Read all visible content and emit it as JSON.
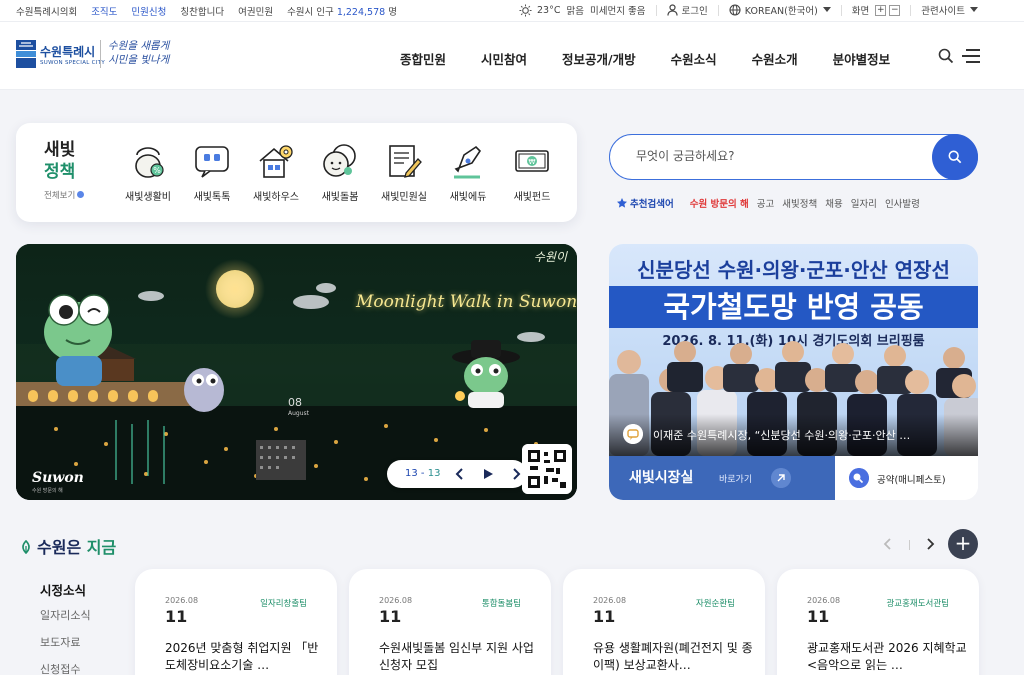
{
  "topbar": {
    "left_links": [
      "수원특례시의회",
      "조직도",
      "민원신청",
      "칭찬합니다",
      "여권민원"
    ],
    "population_label": "수원시 인구",
    "population_value": "1,224,578",
    "population_unit": "명",
    "weather_temp": "23°C",
    "weather_state": "맑음",
    "dust": "미세먼지 좋음",
    "login": "로그인",
    "language": "KOREAN(한국어)",
    "screen_label": "화면",
    "zoom_in": "+",
    "zoom_out": "−",
    "related_sites": "관련사이트"
  },
  "header": {
    "logo_name": "수원특례시",
    "logo_en": "SUWON SPECIAL CITY",
    "slogan_line1": "수원을 새롭게",
    "slogan_line2": "시민을 빛나게",
    "nav": [
      "종합민원",
      "시민참여",
      "정보공개/개방",
      "수원소식",
      "수원소개",
      "분야별정보"
    ]
  },
  "quick_menu": {
    "title_line1": "새빛",
    "title_line2": "정책",
    "view_all": "전체보기",
    "items": [
      "새빛생활비",
      "새빛톡톡",
      "새빛하우스",
      "새빛돌봄",
      "새빛민원실",
      "새빛에듀",
      "새빛펀드"
    ]
  },
  "search": {
    "placeholder": "무엇이 궁금하세요?",
    "keywords_label": "추천검색어",
    "keywords": [
      "수원 방문의 해",
      "공고",
      "새빛정책",
      "채용",
      "일자리",
      "인사발령"
    ]
  },
  "banner": {
    "headline": "Moonlight Walk in Suwon!",
    "tag": "수원이",
    "date": "08",
    "date_sub": "August",
    "brand": "Suwon",
    "brand_sub": "수원 방문의 해",
    "counter_current": "13",
    "counter_total": "13",
    "counter_sep": " - "
  },
  "cityhall": {
    "headline1": "신분당선 수원·의왕·군포·안산 연장선",
    "headline2": "국가철도망 반영 공동",
    "headline3": "2026. 8. 11.(화) 10시   경기도의회 브리핑룸",
    "caption": "이재준 수원특례시장, “신분당선 수원·의왕·군포·안산 …",
    "link_title": "새빛시장실",
    "link_go": "바로가기",
    "manifesto": "공약(매니페스토)"
  },
  "now": {
    "title_a": "수원은",
    "title_b": "지금",
    "plus": "+",
    "tabs": [
      "시정소식",
      "일자리소식",
      "보도자료",
      "신청접수"
    ],
    "cards": [
      {
        "date": "2026.08",
        "day": "11",
        "dept": "일자리창출팀",
        "title": "2026년 맞춤형 취업지원 「반도체장비요소기술 …"
      },
      {
        "date": "2026.08",
        "day": "11",
        "dept": "통합돌봄팀",
        "title": "수원새빛돌봄 임신부 지원 사업 신청자 모집"
      },
      {
        "date": "2026.08",
        "day": "11",
        "dept": "자원순환팀",
        "title": "유용 생활폐자원(폐건전지 및 종이팩) 보상교환사…"
      },
      {
        "date": "2026.08",
        "day": "11",
        "dept": "광교홍재도서관팀",
        "title": "광교홍재도서관 2026 지혜학교 <음악으로 읽는 …"
      }
    ]
  },
  "colors": {
    "primary": "#2f5fd4",
    "green": "#1f8f6a",
    "navy": "#1a2a5a",
    "hot": "#e03a3a"
  }
}
